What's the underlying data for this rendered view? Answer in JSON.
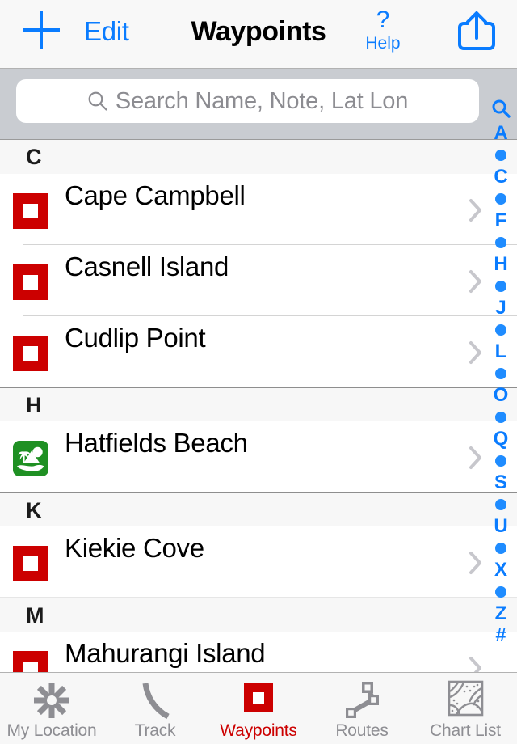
{
  "navbar": {
    "add_label": "+",
    "add_icon": "plus-icon",
    "edit_label": "Edit",
    "title": "Waypoints",
    "help_mark": "?",
    "help_label": "Help",
    "share_icon": "share-icon",
    "accent_color": "#0a7cff"
  },
  "search": {
    "placeholder": "Search Name, Note, Lat Lon",
    "value": "",
    "icon": "search-icon"
  },
  "list": {
    "sections": [
      {
        "letter": "C",
        "rows": [
          {
            "title": "Cape Campbell",
            "icon": "red-square-waypoint-icon",
            "icon_type": "red",
            "chevron": "chevron-right-icon"
          },
          {
            "title": "Casnell Island",
            "icon": "red-square-waypoint-icon",
            "icon_type": "red",
            "chevron": "chevron-right-icon"
          },
          {
            "title": "Cudlip Point",
            "icon": "red-square-waypoint-icon",
            "icon_type": "red",
            "chevron": "chevron-right-icon"
          }
        ]
      },
      {
        "letter": "H",
        "rows": [
          {
            "title": "Hatfields Beach",
            "icon": "green-island-waypoint-icon",
            "icon_type": "island",
            "chevron": "chevron-right-icon"
          }
        ]
      },
      {
        "letter": "K",
        "rows": [
          {
            "title": "Kiekie Cove",
            "icon": "red-square-waypoint-icon",
            "icon_type": "red",
            "chevron": "chevron-right-icon"
          }
        ]
      },
      {
        "letter": "M",
        "rows": [
          {
            "title": "Mahurangi Island",
            "icon": "red-square-waypoint-icon",
            "icon_type": "red",
            "chevron": "chevron-right-icon"
          }
        ]
      }
    ]
  },
  "index_bar": {
    "entries": [
      {
        "type": "icon",
        "label": "search-icon"
      },
      {
        "type": "letter",
        "label": "A"
      },
      {
        "type": "dot",
        "label": "•"
      },
      {
        "type": "letter",
        "label": "C"
      },
      {
        "type": "dot",
        "label": "•"
      },
      {
        "type": "letter",
        "label": "F"
      },
      {
        "type": "dot",
        "label": "•"
      },
      {
        "type": "letter",
        "label": "H"
      },
      {
        "type": "dot",
        "label": "•"
      },
      {
        "type": "letter",
        "label": "J"
      },
      {
        "type": "dot",
        "label": "•"
      },
      {
        "type": "letter",
        "label": "L"
      },
      {
        "type": "dot",
        "label": "•"
      },
      {
        "type": "letter",
        "label": "O"
      },
      {
        "type": "dot",
        "label": "•"
      },
      {
        "type": "letter",
        "label": "Q"
      },
      {
        "type": "dot",
        "label": "•"
      },
      {
        "type": "letter",
        "label": "S"
      },
      {
        "type": "dot",
        "label": "•"
      },
      {
        "type": "letter",
        "label": "U"
      },
      {
        "type": "dot",
        "label": "•"
      },
      {
        "type": "letter",
        "label": "X"
      },
      {
        "type": "dot",
        "label": "•"
      },
      {
        "type": "letter",
        "label": "Z"
      },
      {
        "type": "letter",
        "label": "#"
      }
    ]
  },
  "tabbar": {
    "active_color": "#cc0000",
    "inactive_color": "#8e8e93",
    "tabs": [
      {
        "label": "My Location",
        "icon": "asterisk-location-icon",
        "active": false
      },
      {
        "label": "Track",
        "icon": "track-curve-icon",
        "active": false
      },
      {
        "label": "Waypoints",
        "icon": "red-square-waypoint-icon",
        "active": true
      },
      {
        "label": "Routes",
        "icon": "route-nodes-icon",
        "active": false
      },
      {
        "label": "Chart List",
        "icon": "chart-map-icon",
        "active": false
      }
    ]
  }
}
